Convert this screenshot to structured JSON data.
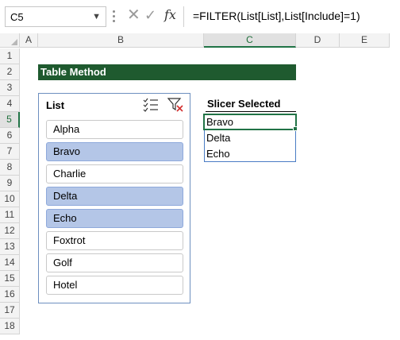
{
  "formula_bar": {
    "name_box": "C5",
    "formula": "=FILTER(List[List],List[Include]=1)",
    "cancel_icon": "x-icon",
    "enter_icon": "check-icon",
    "insert_function_label": "fx"
  },
  "grid": {
    "columns": [
      "A",
      "B",
      "C",
      "D",
      "E"
    ],
    "rows": [
      "1",
      "2",
      "3",
      "4",
      "5",
      "6",
      "7",
      "8",
      "9",
      "10",
      "11",
      "12",
      "13",
      "14",
      "15",
      "16",
      "17",
      "18"
    ],
    "active_column": "C",
    "active_row": "5"
  },
  "title": "Table Method",
  "slicer": {
    "header": "List",
    "multi_select_icon": "multi-select-icon",
    "clear_filter_icon": "clear-filter-icon",
    "items": [
      {
        "label": "Alpha",
        "selected": false
      },
      {
        "label": "Bravo",
        "selected": true
      },
      {
        "label": "Charlie",
        "selected": false
      },
      {
        "label": "Delta",
        "selected": true
      },
      {
        "label": "Echo",
        "selected": true
      },
      {
        "label": "Foxtrot",
        "selected": false
      },
      {
        "label": "Golf",
        "selected": false
      },
      {
        "label": "Hotel",
        "selected": false
      }
    ]
  },
  "result": {
    "header": "Slicer Selected",
    "values": [
      "Bravo",
      "Delta",
      "Echo"
    ]
  },
  "colors": {
    "title_fill": "#1f5a2f",
    "selected_item_fill": "#b4c6e7",
    "active_cell_border": "#217346",
    "slicer_border": "#6d8fbf"
  }
}
